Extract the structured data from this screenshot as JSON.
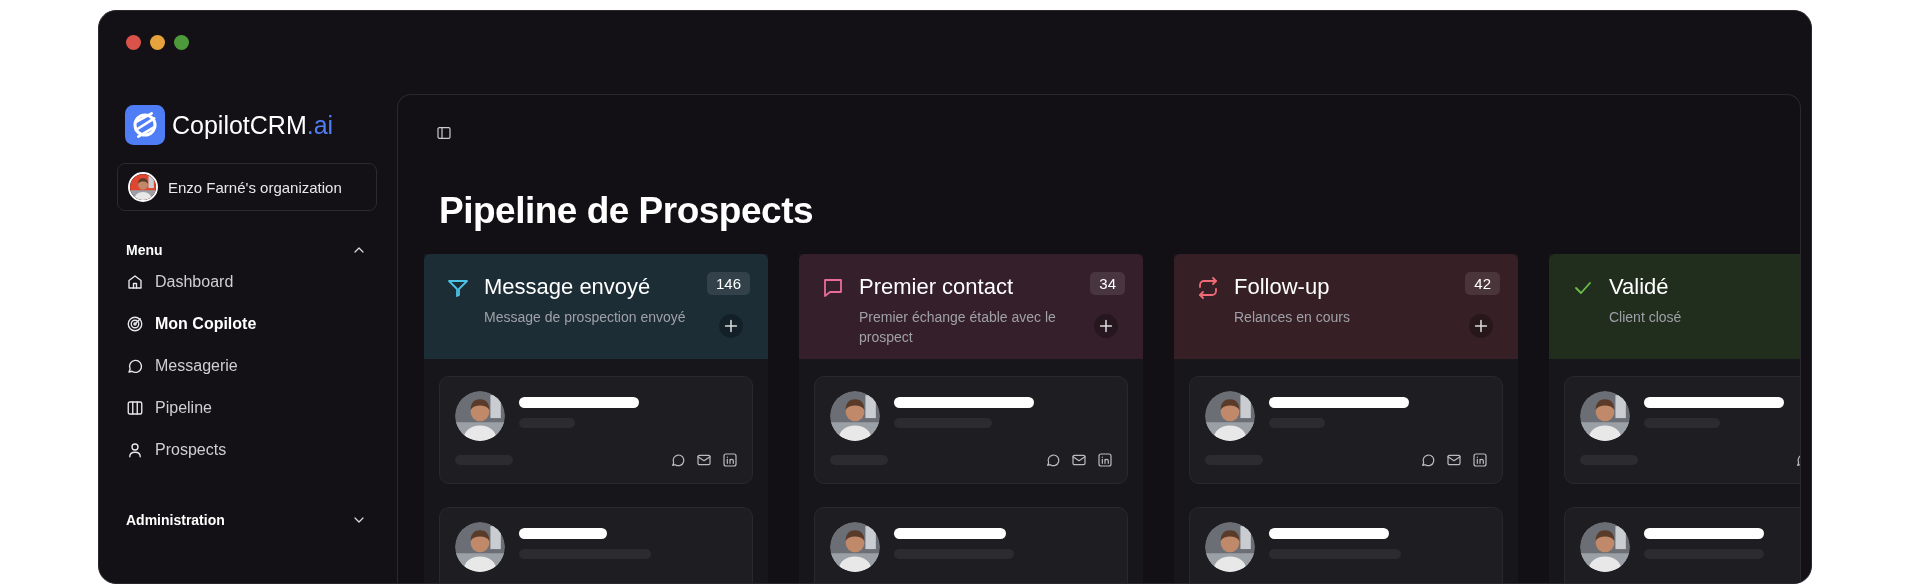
{
  "window": {
    "controls": [
      {
        "color": "#d9534a"
      },
      {
        "color": "#e6a23c"
      },
      {
        "color": "#4c9a3a"
      }
    ]
  },
  "sidebar": {
    "brand": {
      "name": "CopilotCRM",
      "suffix": ".ai"
    },
    "organization": {
      "avatar": {
        "kind": "picture"
      },
      "label": "Enzo Farné's organization"
    },
    "sections": [
      {
        "title": "Menu",
        "expanded": true,
        "items": [
          {
            "kind": "home",
            "label": "Dashboard",
            "selected": false
          },
          {
            "kind": "radar",
            "label": "Mon Copilote",
            "selected": true
          },
          {
            "kind": "chat",
            "label": "Messagerie",
            "selected": false
          },
          {
            "kind": "columns",
            "label": "Pipeline",
            "selected": false
          },
          {
            "kind": "user",
            "label": "Prospects",
            "selected": false
          }
        ]
      },
      {
        "title": "Administration",
        "expanded": false
      }
    ]
  },
  "main": {
    "title": "Pipeline de Prospects",
    "columns": [
      {
        "kind": "sent",
        "color": "#4cc3e6",
        "title": "Message envoyé",
        "subtitle": "Message de prospection envoyé",
        "count": "146",
        "add_button": true,
        "cards": [
          {
            "avatar": {
              "kind": "picture"
            },
            "icons": [
              {
                "kind": "chat"
              },
              {
                "kind": "mail"
              },
              {
                "kind": "linkedin"
              }
            ]
          },
          {
            "avatar": {
              "kind": "picture"
            }
          }
        ]
      },
      {
        "kind": "contact",
        "color": "#e86b9a",
        "title": "Premier contact",
        "subtitle": "Premier échange étable avec le prospect",
        "count": "34",
        "add_button": true,
        "cards": [
          {
            "avatar": {
              "kind": "picture"
            },
            "icons": [
              {
                "kind": "chat"
              },
              {
                "kind": "mail"
              },
              {
                "kind": "linkedin"
              }
            ]
          },
          {
            "avatar": {
              "kind": "picture"
            }
          }
        ]
      },
      {
        "kind": "followup",
        "color": "#ef6b78",
        "title": "Follow-up",
        "subtitle": "Relances en cours",
        "count": "42",
        "add_button": true,
        "cards": [
          {
            "avatar": {
              "kind": "picture"
            },
            "icons": [
              {
                "kind": "chat"
              },
              {
                "kind": "mail"
              },
              {
                "kind": "linkedin"
              }
            ]
          },
          {
            "avatar": {
              "kind": "picture"
            }
          }
        ]
      },
      {
        "kind": "won",
        "color": "#6cc04a",
        "title": "Validé",
        "subtitle": "Client closé",
        "add_button": false,
        "cards": [
          {
            "avatar": {
              "kind": "picture"
            },
            "icons": [
              {
                "kind": "chat"
              }
            ]
          },
          {
            "avatar": {
              "kind": "picture"
            }
          }
        ]
      }
    ]
  }
}
